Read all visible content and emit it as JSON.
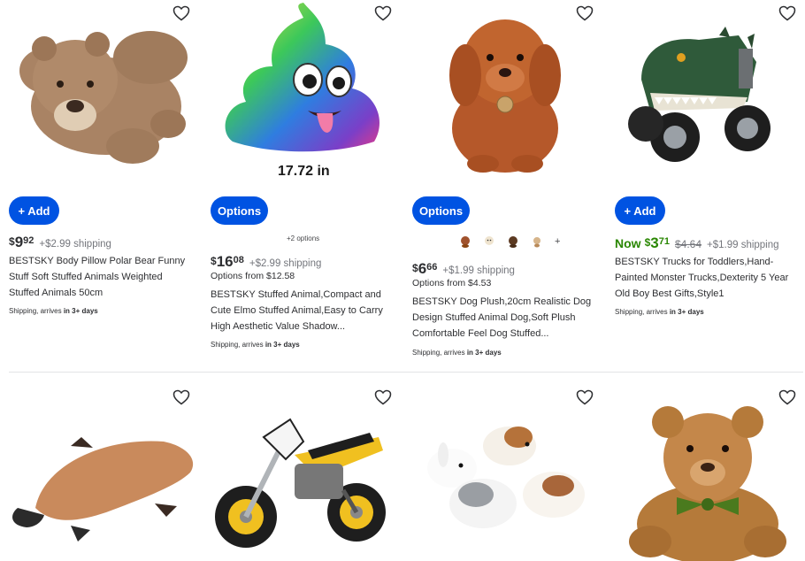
{
  "products": [
    {
      "image": "polar-bear-plush",
      "action": "+ Add",
      "price_dollars": "9",
      "price_cents": "92",
      "shipping": "+$2.99 shipping",
      "title": "BESTSKY Body Pillow Polar Bear Funny Stuff Soft Stuffed Animals Weighted Stuffed Animals 50cm",
      "delivery_prefix": "Shipping, arrives",
      "delivery_time": "in 3+ days"
    },
    {
      "image": "rainbow-poop-pillow",
      "image_caption": "17.72 in",
      "action": "Options",
      "more_options": "+2 options",
      "price_dollars": "16",
      "price_cents": "08",
      "shipping": "+$2.99 shipping",
      "options_from": "Options from $12.58",
      "title": "BESTSKY Stuffed Animal,Compact and Cute Elmo Stuffed Animal,Easy to Carry High Aesthetic Value Shadow...",
      "delivery_prefix": "Shipping, arrives",
      "delivery_time": "in 3+ days"
    },
    {
      "image": "dog-plush",
      "action": "Options",
      "swatch_more": "+",
      "price_dollars": "6",
      "price_cents": "66",
      "shipping": "+$1.99 shipping",
      "options_from": "Options from $4.53",
      "title": "BESTSKY Dog Plush,20cm Realistic Dog Design Stuffed Animal Dog,Soft Plush Comfortable Feel Dog Stuffed...",
      "delivery_prefix": "Shipping, arrives",
      "delivery_time": "in 3+ days"
    },
    {
      "image": "dinosaur-monster-truck",
      "action": "+ Add",
      "now_label": "Now",
      "price_dollars": "3",
      "price_cents": "71",
      "was_price": "$4.64",
      "shipping": "+$1.99 shipping",
      "title": "BESTSKY Trucks for Toddlers,Hand-Painted Monster Trucks,Dexterity 5 Year Old Boy Best Gifts,Style1",
      "delivery_prefix": "Shipping, arrives",
      "delivery_time": "in 3+ days"
    },
    {
      "image": "platypus-plush"
    },
    {
      "image": "motocross-bike-model"
    },
    {
      "image": "bunny-plush-set"
    },
    {
      "image": "teddy-bear-with-bow"
    }
  ],
  "colors": {
    "primary_button": "#0053e2",
    "now_price": "#2a8703",
    "secondary_text": "#74767c"
  }
}
